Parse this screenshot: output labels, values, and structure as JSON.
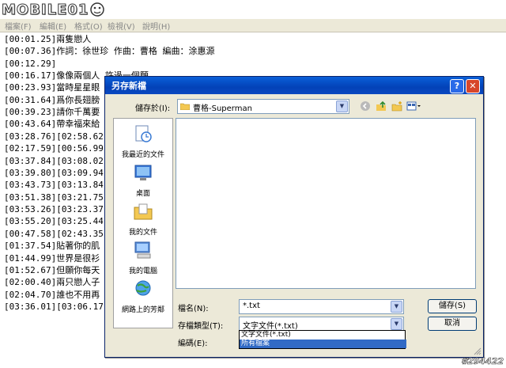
{
  "logo": {
    "text": "MOBILE01"
  },
  "menubar": {
    "items": [
      "檔案(F)",
      "編輯(E)",
      "格式(O)",
      "檢視(V)",
      "說明(H)"
    ]
  },
  "editor": {
    "lines": [
      "[00:01.25]兩隻戀人",
      "[00:07.36]作詞：徐世珍  作曲：曹格  編曲：涂惠源",
      "[00:12.29]",
      "[00:16.17]像像兩個人  許過一個願",
      "[00:23.93]當時星星眼",
      "[00:31.64]爲你長翅膀",
      "[00:39.23]請你千萬要",
      "[00:43.64]帶幸福來給",
      "[03:28.76][02:58.62",
      "[02:17.59][00:56.99",
      "[03:37.84][03:08.02",
      "[03:39.80][03:09.94",
      "[03:43.73][03:13.84",
      "[03:51.38][03:21.75",
      "[03:53.26][03:23.37",
      "[03:55.20][03:25.44",
      "[00:47.58][02:43.35",
      "[01:37.54]貼著你的肌",
      "[01:44.99]世界是很衫",
      "[01:52.67]但願你每天",
      "[02:00.40]兩只戀人子",
      "[02:04.70]誰也不用再",
      "[03:36.01][03:06.17"
    ]
  },
  "dialog": {
    "title": "另存新檔",
    "help_glyph": "?",
    "close_glyph": "✕",
    "save_in_label": "儲存於(I):",
    "save_in_value": "曹格-Superman",
    "places": [
      {
        "label": "我最近的文件",
        "icon": "recent-documents-icon"
      },
      {
        "label": "桌面",
        "icon": "desktop-icon"
      },
      {
        "label": "我的文件",
        "icon": "my-documents-icon"
      },
      {
        "label": "我的電腦",
        "icon": "my-computer-icon"
      },
      {
        "label": "網路上的芳鄰",
        "icon": "network-places-icon"
      }
    ],
    "filename_label": "檔名(N):",
    "filename_value": "*.txt",
    "filetype_label": "存檔類型(T):",
    "filetype_value": "文字文件(*.txt)",
    "encoding_label": "編碼(E):",
    "save_button": "儲存(S)",
    "cancel_button": "取消",
    "filetype_options": [
      "文字文件(*.txt)",
      "所有檔案"
    ]
  },
  "watermark": {
    "text": "#294422"
  },
  "colors": {
    "titlebar": "#0a5fd8",
    "selection": "#316ac5",
    "dialog_bg": "#ece9d8"
  }
}
